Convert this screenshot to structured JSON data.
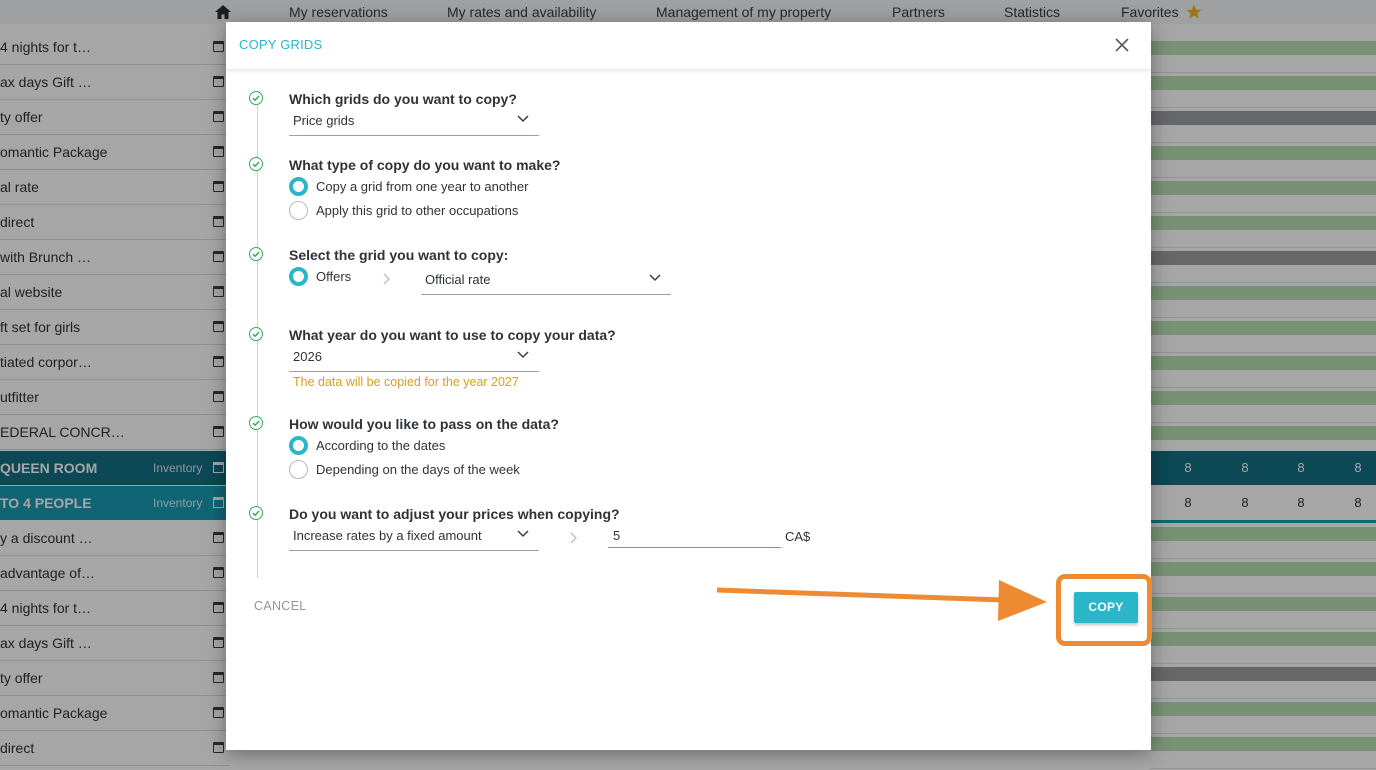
{
  "nav": {
    "items": [
      "My reservations",
      "My rates and availability",
      "Management of my property",
      "Partners",
      "Statistics",
      "Favorites"
    ]
  },
  "offers": [
    "4 nights for t…",
    "ax days Gift …",
    "ty offer",
    "omantic Package",
    "al rate",
    " direct",
    " with Brunch …",
    "al website",
    "ft set for girls",
    "tiated corpor…",
    "utfitter",
    "EDERAL CONCR…"
  ],
  "rooms": [
    {
      "name": "QUEEN ROOM",
      "inventory": "Inventory"
    },
    {
      "name": "TO 4 PEOPLE",
      "inventory": "Inventory"
    }
  ],
  "offers_bottom": [
    "y a discount …",
    " advantage of…",
    "4 nights for t…",
    "ax days Gift …",
    "ty offer",
    "omantic Package",
    " direct"
  ],
  "room_values": [
    "8",
    "8",
    "8",
    "8"
  ],
  "dialog": {
    "title": "COPY GRIDS",
    "q1": "Which grids do you want to copy?",
    "q1_value": "Price grids",
    "q2": "What type of copy do you want to make?",
    "q2_opt1": "Copy a grid from one year to another",
    "q2_opt2": "Apply this grid to other occupations",
    "q3": "Select the grid you want to copy:",
    "q3_radio": "Offers",
    "q3_value": "Official rate",
    "q4": "What year do you want to use to copy your data?",
    "q4_value": "2026",
    "q4_hint": "The data will be copied for the year 2027",
    "q5": "How would you like to pass on the data?",
    "q5_opt1": "According to the dates",
    "q5_opt2": "Depending on the days of the week",
    "q6": "Do you want to adjust your prices when copying?",
    "q6_value": "Increase rates by a fixed amount",
    "q6_amount": "5",
    "q6_currency": "CA$",
    "cancel": "CANCEL",
    "copy": "COPY"
  },
  "colors": {
    "accent": "#29b6c9",
    "check": "#39a958",
    "warning_text": "#d6a021",
    "annotation": "#ee8b32",
    "room_row_dark": "#136f83",
    "room_row_light": "#1a9cb4"
  },
  "icons": [
    "home-icon",
    "star-icon",
    "calendar-icon",
    "close-icon",
    "check-circle-icon",
    "chevron-down-icon",
    "chevron-right-icon"
  ]
}
